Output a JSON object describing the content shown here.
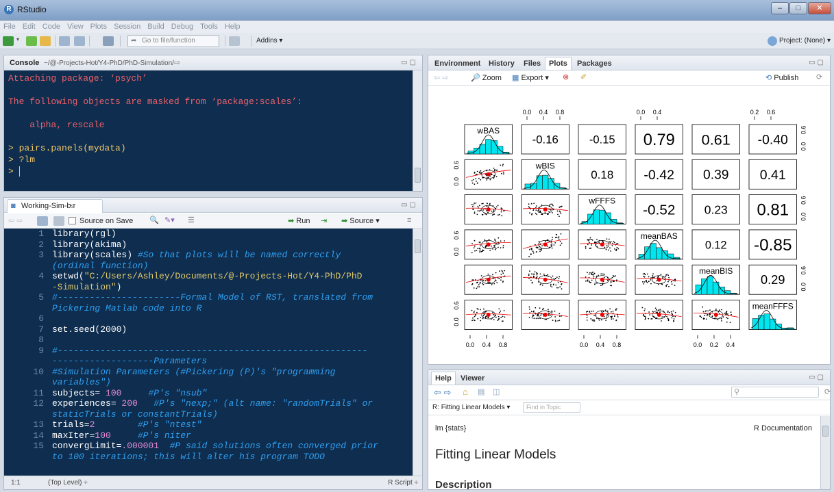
{
  "window": {
    "title": "RStudio"
  },
  "menu": [
    "File",
    "Edit",
    "Code",
    "View",
    "Plots",
    "Session",
    "Build",
    "Debug",
    "Tools",
    "Help"
  ],
  "toolbar": {
    "goto_placeholder": "Go to file/function",
    "addins_label": "Addins ▾",
    "project_label": "Project: (None) ▾"
  },
  "console": {
    "title": "Console",
    "path": "~/@-Projects-Hot/Y4-PhD/PhD-Simulation/",
    "lines": [
      {
        "text": "Attaching package: ‘psych’",
        "kind": "msg"
      },
      {
        "text": "",
        "kind": "msg"
      },
      {
        "text": "The following objects are masked from ‘package:scales’:",
        "kind": "msg"
      },
      {
        "text": "",
        "kind": "msg"
      },
      {
        "text": "    alpha, rescale",
        "kind": "msg"
      },
      {
        "text": "",
        "kind": "msg"
      },
      {
        "text": "> pairs.panels(mydata)",
        "kind": "cmd"
      },
      {
        "text": "> ?lm",
        "kind": "cmd"
      },
      {
        "text": "> ",
        "kind": "cmd"
      }
    ]
  },
  "editor": {
    "tab_label": "Working-Sim-b.r",
    "source_on_save": "Source on Save",
    "run_label": "Run",
    "source_label": "Source",
    "status_position": "1:1",
    "status_scope": "(Top Level) ÷",
    "status_type": "R Script ÷",
    "lines": [
      {
        "n": "1",
        "code": "library(rgl)"
      },
      {
        "n": "2",
        "code": "library(akima)"
      },
      {
        "n": "3",
        "code": "library(scales) ",
        "comment": "#So that plots will be named correctly"
      },
      {
        "n": "",
        "comment": "(ordinal function)"
      },
      {
        "n": "4",
        "code": "setwd(",
        "str": "\"C:/Users/Ashley/Documents/@-Projects-Hot/Y4-PhD/PhD"
      },
      {
        "n": "",
        "str": "-Simulation\"",
        "code2": ")"
      },
      {
        "n": "5",
        "comment": "#-----------------------Formal Model of RST, translated from"
      },
      {
        "n": "",
        "comment": "Pickering Matlab code into R"
      },
      {
        "n": "6"
      },
      {
        "n": "7",
        "code": "set.seed(2000)"
      },
      {
        "n": "8"
      },
      {
        "n": "9",
        "comment": "#----------------------------------------------------------"
      },
      {
        "n": "",
        "comment": "-------------------Parameters"
      },
      {
        "n": "10",
        "comment": "#Simulation Parameters (#Pickering (P)'s \"programming"
      },
      {
        "n": "",
        "comment": "variables\")"
      },
      {
        "n": "11",
        "code": "subjects= ",
        "num": "100",
        "comment": "     #P's \"nsub\""
      },
      {
        "n": "12",
        "code": "experiences= ",
        "num": "200",
        "comment": "   #P's \"nexp;\" (alt name: \"randomTrials\" or"
      },
      {
        "n": "",
        "comment": "staticTrials or constantTrials)"
      },
      {
        "n": "13",
        "code": "trials=",
        "num": "2",
        "comment": "        #P's \"ntest\""
      },
      {
        "n": "14",
        "code": "maxIter=",
        "num": "100",
        "comment": "     #P's niter"
      },
      {
        "n": "15",
        "code": "convergLimit=",
        "num": ".000001",
        "comment": "  #P said solutions often converged prior"
      },
      {
        "n": "",
        "comment": "to 100 iterations; this will alter his program TODO"
      }
    ]
  },
  "env": {
    "tabs": [
      "Environment",
      "History",
      "Files",
      "Plots",
      "Packages"
    ],
    "active_tab": "Plots",
    "zoom_label": "Zoom",
    "export_label": "Export ▾",
    "publish_label": "Publish"
  },
  "pairs": {
    "vars": [
      "wBAS",
      "wBIS",
      "wFFFS",
      "meanBAS",
      "meanBIS",
      "meanFFFS"
    ],
    "corr": [
      [
        "-0.16",
        "-0.15",
        "0.79",
        "0.61",
        "-0.40"
      ],
      [
        "0.18",
        "-0.42",
        "0.39",
        "0.41"
      ],
      [
        "-0.52",
        "0.23",
        "0.81"
      ],
      [
        "0.12",
        "-0.85"
      ],
      [
        "0.29"
      ]
    ],
    "top_ticks": [
      [
        "0.0",
        "0.4",
        "0.8"
      ],
      [
        "0.0",
        "0.4"
      ],
      [
        "0.2",
        "0.6"
      ]
    ],
    "bottom_ticks": [
      [
        "0.0",
        "0.4",
        "0.8"
      ],
      [
        "0.0",
        "0.4",
        "0.8"
      ],
      [
        "0.0",
        "0.2",
        "0.4"
      ]
    ],
    "side_ticks": [
      "0.6",
      "0.0"
    ],
    "hist_color": "#00e5ee"
  },
  "help": {
    "tabs": [
      "Help",
      "Viewer"
    ],
    "active_tab": "Help",
    "topic_label": "R: Fitting Linear Models ▾",
    "find_placeholder": "Find in Topic",
    "pkg_label": "lm {stats}",
    "doc_label": "R Documentation",
    "heading": "Fitting Linear Models",
    "section": "Description"
  }
}
